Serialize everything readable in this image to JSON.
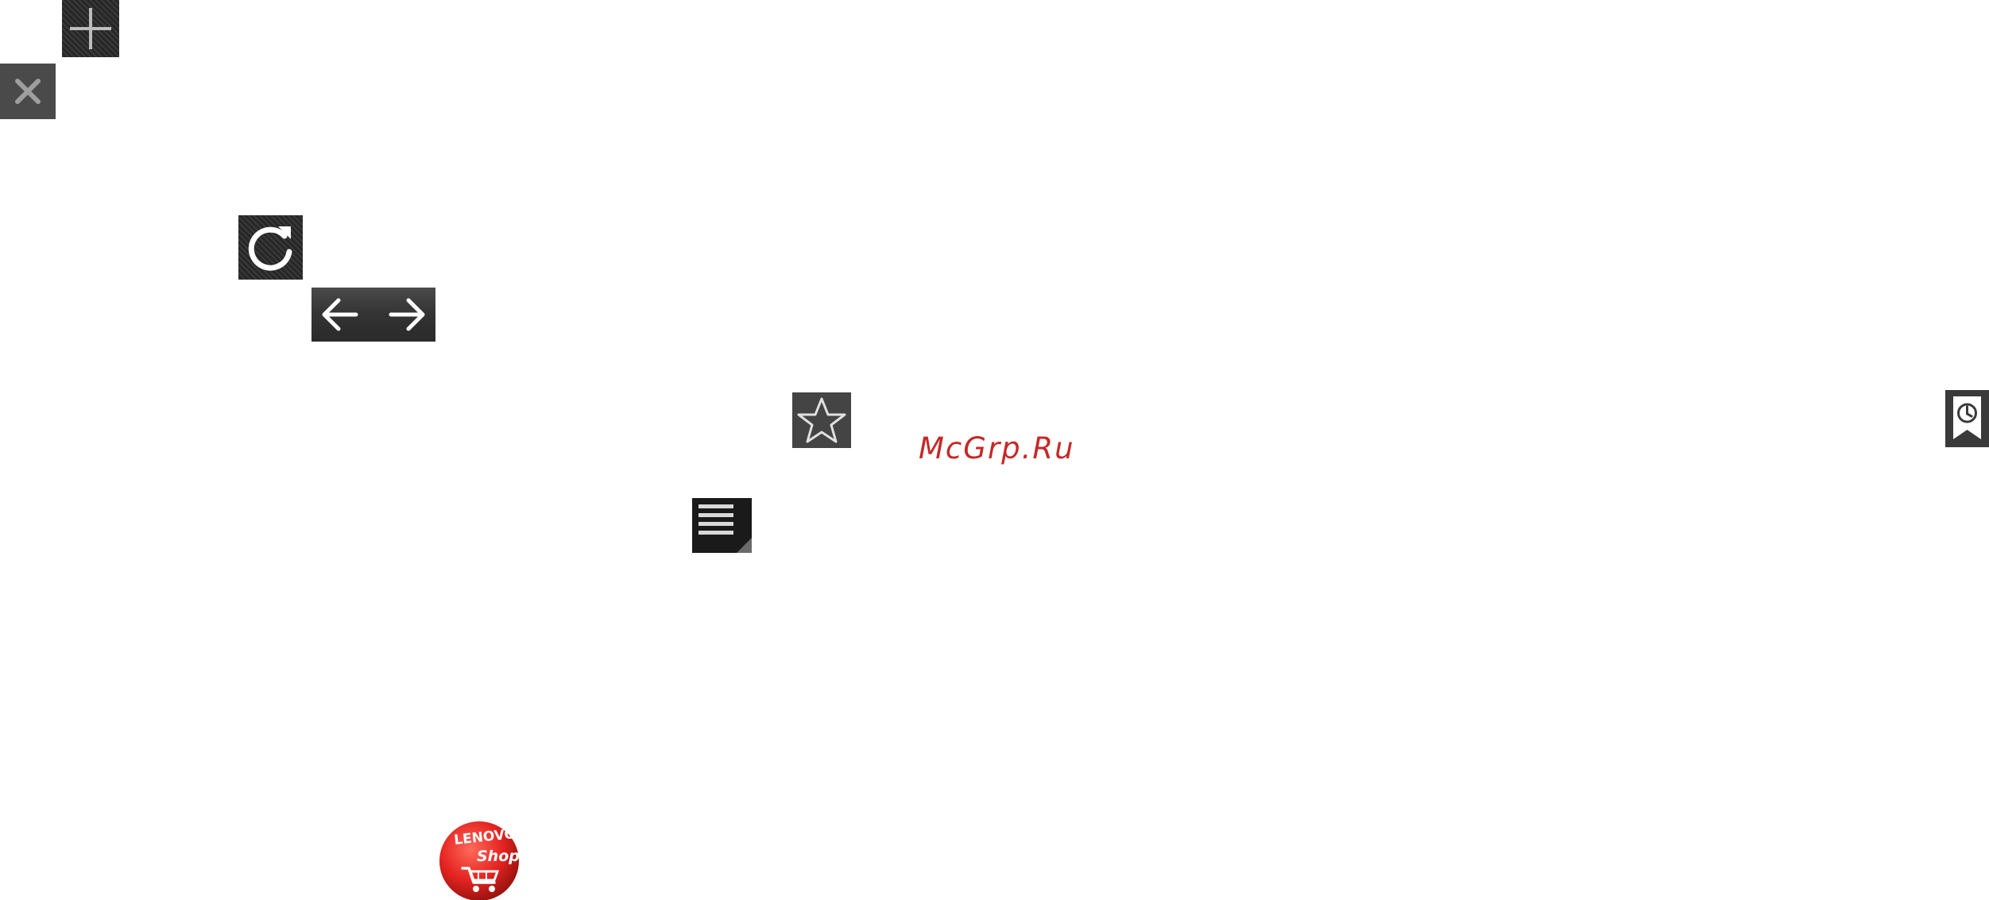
{
  "icons": {
    "add_tab": "plus-icon",
    "close_tab": "close-icon",
    "refresh": "refresh-icon",
    "back": "arrow-left-icon",
    "forward": "arrow-right-icon",
    "bookmark": "star-icon",
    "menu": "menu-icon",
    "history": "bookmark-clock-icon",
    "shop": "lenovo-shop-logo"
  },
  "watermark": "McGrp.Ru",
  "colors": {
    "watermark": "#c62828",
    "button_dark": "#383838",
    "shop_red": "#e52421"
  }
}
